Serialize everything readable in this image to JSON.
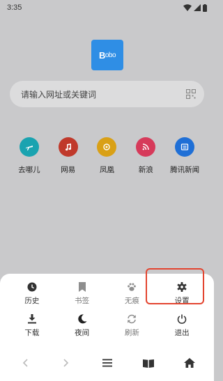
{
  "status_bar": {
    "time": "3:35"
  },
  "logo": {
    "text_main": "B",
    "text_small": "obo"
  },
  "search": {
    "placeholder": "请输入网址或关键词"
  },
  "sites": [
    {
      "label": "去哪儿",
      "color": "#1aa3b0"
    },
    {
      "label": "网易",
      "color": "#c0392b"
    },
    {
      "label": "凤凰",
      "color": "#d9a016"
    },
    {
      "label": "新浪",
      "color": "#d63a5a"
    },
    {
      "label": "腾讯新闻",
      "color": "#1f6fd6"
    }
  ],
  "menu": {
    "row1": [
      {
        "label": "历史",
        "icon": "clock-icon"
      },
      {
        "label": "书签",
        "icon": "bookmark-icon",
        "disabled": true
      },
      {
        "label": "无痕",
        "icon": "paw-icon",
        "disabled": true
      },
      {
        "label": "设置",
        "icon": "gear-icon"
      }
    ],
    "row2": [
      {
        "label": "下载",
        "icon": "download-icon"
      },
      {
        "label": "夜间",
        "icon": "moon-icon"
      },
      {
        "label": "刷新",
        "icon": "refresh-icon",
        "disabled": true
      },
      {
        "label": "退出",
        "icon": "power-icon"
      }
    ]
  },
  "colors": {
    "accent": "#2f8ee5",
    "highlight": "#e3442f"
  }
}
